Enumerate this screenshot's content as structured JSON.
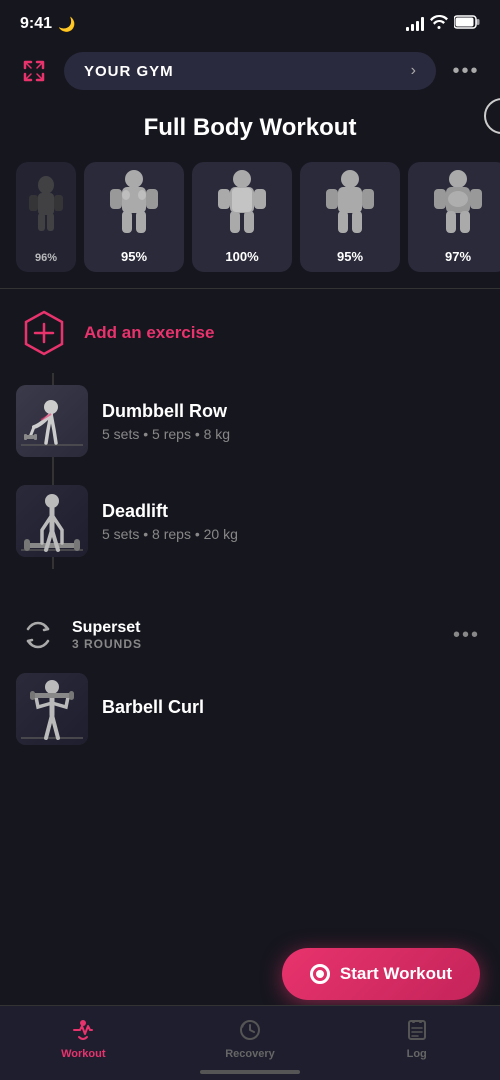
{
  "statusBar": {
    "time": "9:41",
    "moonIcon": "🌙"
  },
  "header": {
    "gymButtonLabel": "YOUR GYM",
    "expandIconLabel": "↗",
    "moreIconLabel": "•••"
  },
  "workoutTitle": "Full Body Workout",
  "muscleCards": [
    {
      "percent": "96%",
      "color": "#555"
    },
    {
      "percent": "95%",
      "color": "#555"
    },
    {
      "percent": "100%",
      "color": "#555"
    },
    {
      "percent": "95%",
      "color": "#555"
    },
    {
      "percent": "97%",
      "color": "#555"
    }
  ],
  "addExercise": {
    "label": "Add an exercise"
  },
  "exercises": [
    {
      "name": "Dumbbell Row",
      "meta": "5 sets • 5 reps • 8 kg"
    },
    {
      "name": "Deadlift",
      "meta": "5 sets • 8 reps • 20 kg"
    }
  ],
  "superset": {
    "label": "Superset",
    "rounds": "3 ROUNDS"
  },
  "supersetExercise": {
    "name": "Barbell Curl",
    "meta": ""
  },
  "startWorkout": {
    "label": "Start Workout"
  },
  "bottomNav": [
    {
      "label": "Workout",
      "active": true
    },
    {
      "label": "Recovery",
      "active": false
    },
    {
      "label": "Log",
      "active": false
    }
  ]
}
